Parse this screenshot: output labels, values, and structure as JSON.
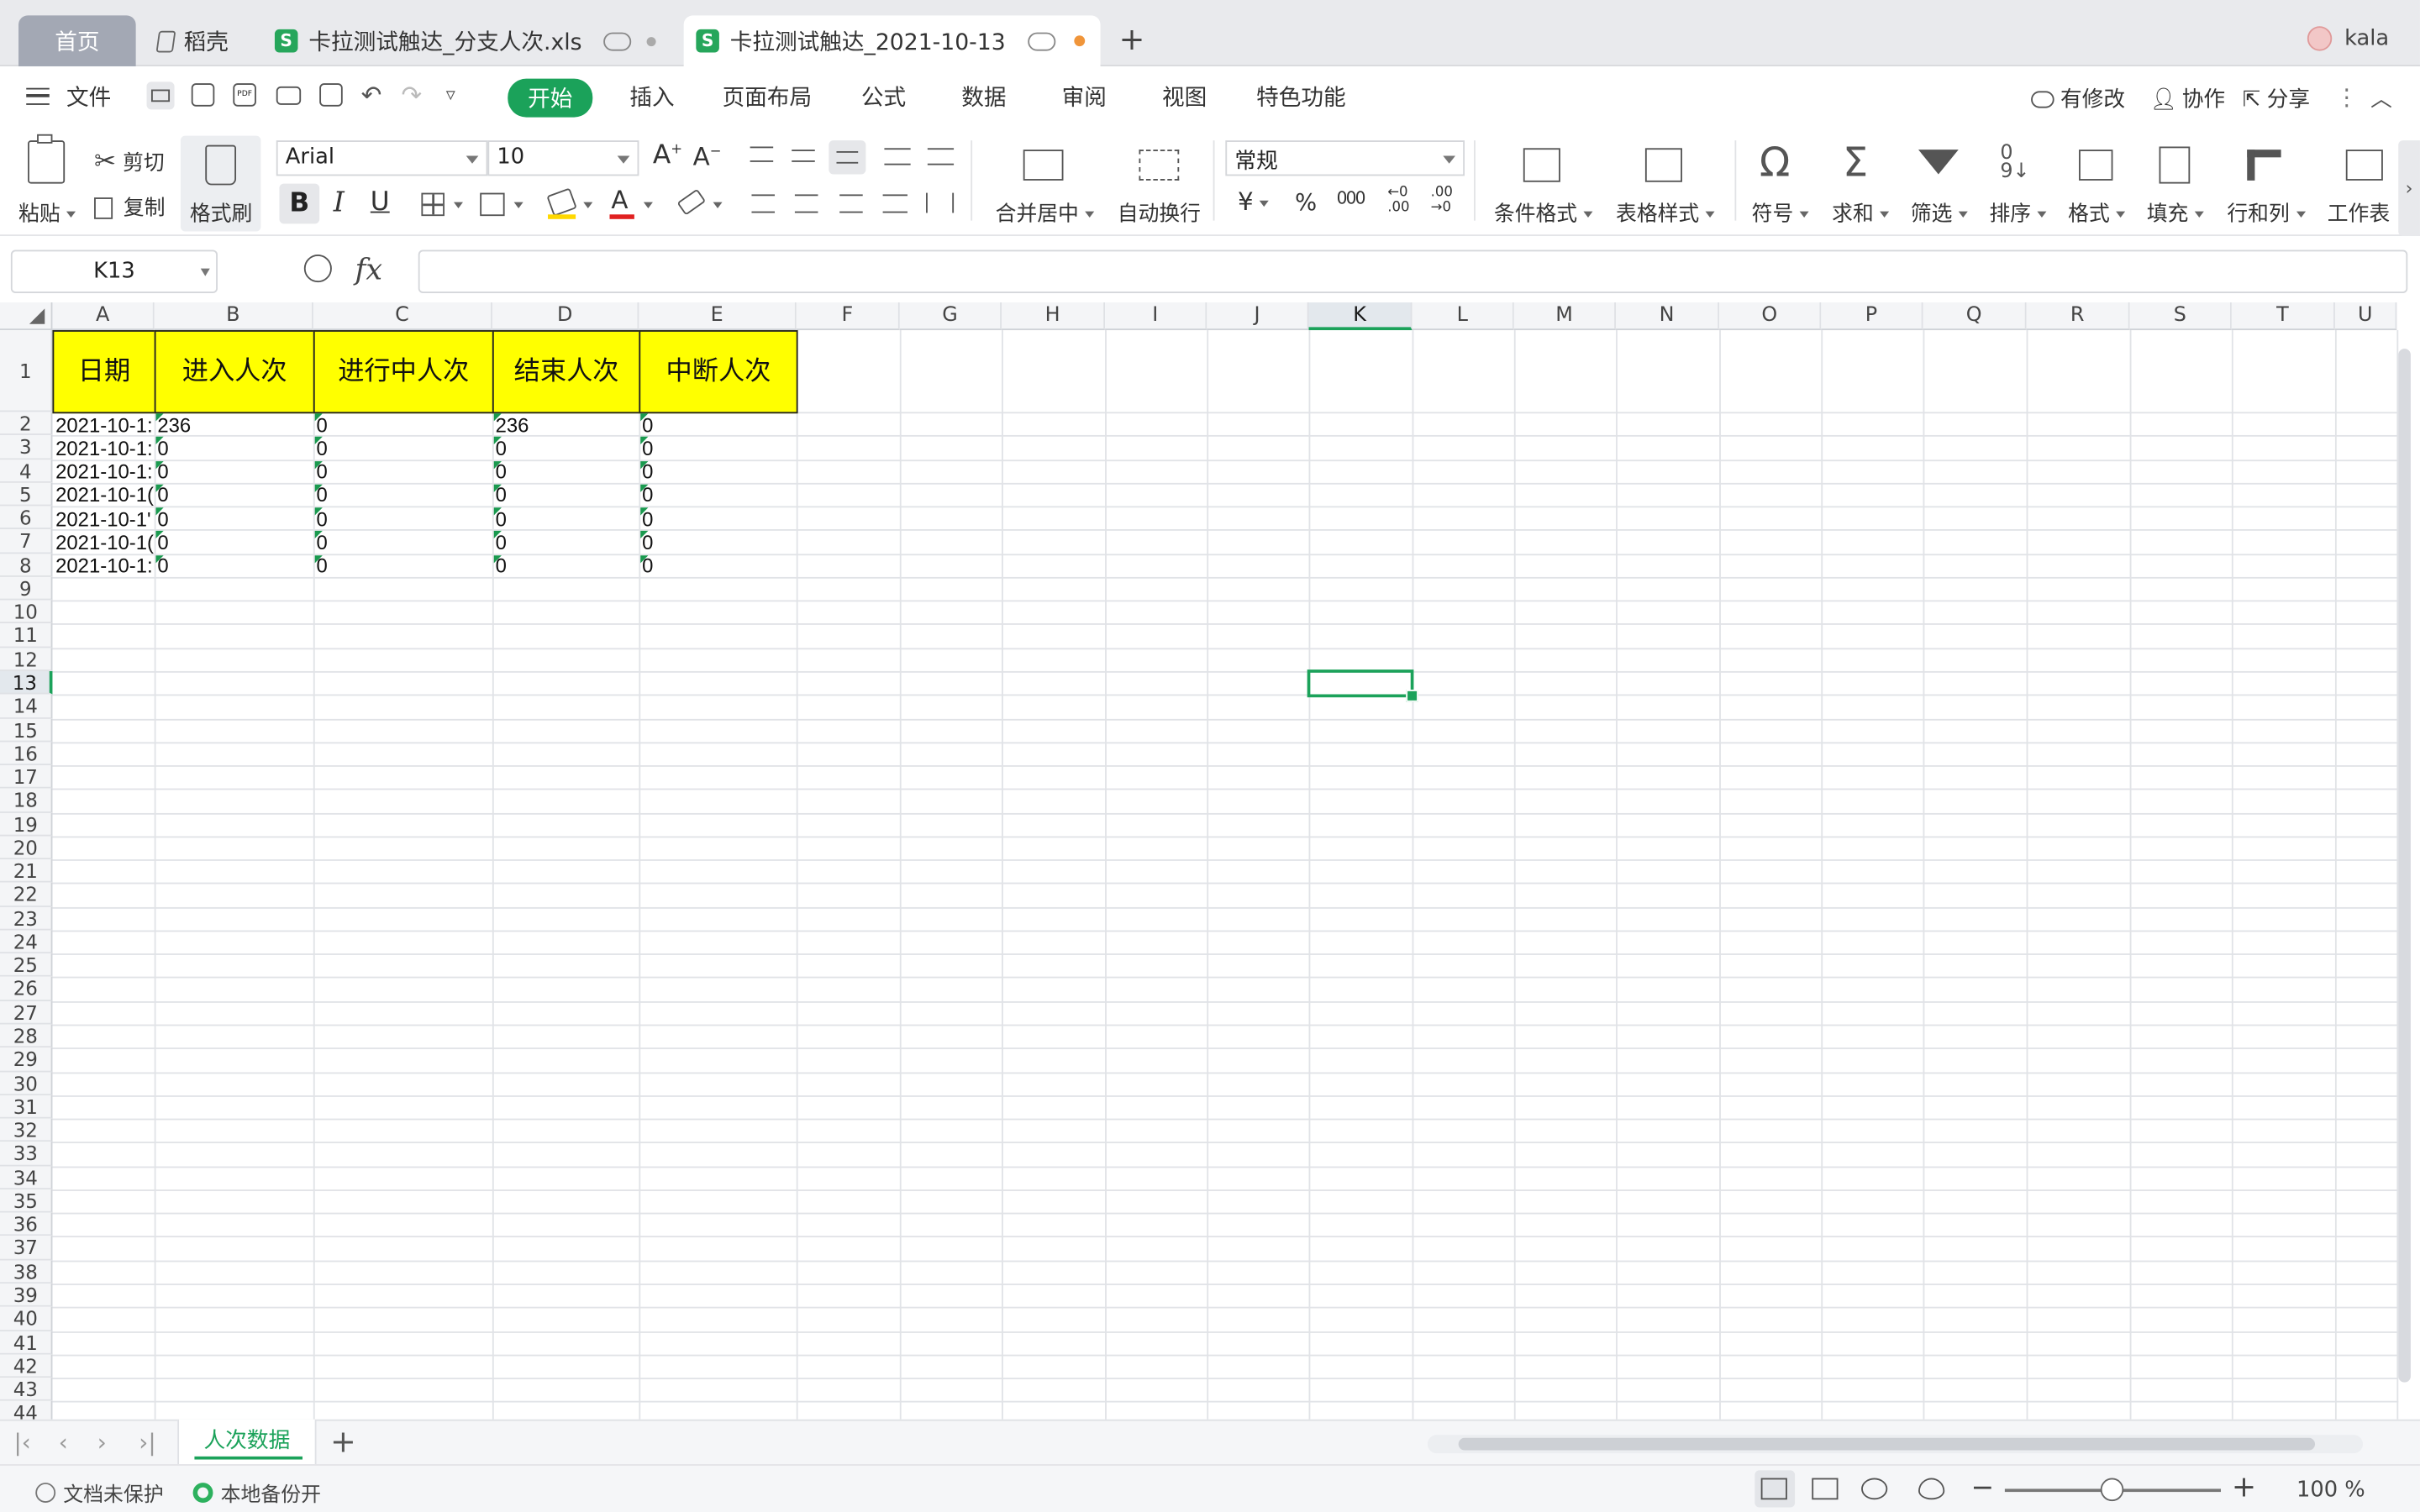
{
  "tabs": {
    "home": "首页",
    "drawer": "稻壳",
    "file1": "卡拉测试触达_分支人次.xls",
    "file2": "卡拉测试触达_2021-10-13",
    "new_tab": "+",
    "file_icon_letter": "S",
    "user": "kala"
  },
  "menu": {
    "file": "文件",
    "items": [
      "开始",
      "插入",
      "页面布局",
      "公式",
      "数据",
      "审阅",
      "视图",
      "特色功能"
    ],
    "has_changes": "有修改",
    "collab": "协作",
    "share": "分享"
  },
  "ribbon": {
    "paste": "粘贴",
    "cut": "剪切",
    "copy": "复制",
    "format_painter": "格式刷",
    "font_name": "Arial",
    "font_size": "10",
    "bold": "B",
    "italic": "I",
    "underline": "U",
    "merge_center": "合并居中",
    "auto_wrap": "自动换行",
    "number_format": "常规",
    "currency": "¥",
    "percent": "%",
    "thousands": "000",
    "inc_decimal": "←0 .00",
    "dec_decimal": ".00 →0",
    "cond_format": "条件格式",
    "table_style": "表格样式",
    "symbol": "符号",
    "sum": "求和",
    "filter": "筛选",
    "sort": "排序",
    "format": "格式",
    "fill": "填充",
    "row_col": "行和列",
    "worksheet": "工作表"
  },
  "formula_bar": {
    "name_box": "K13",
    "fx": "fx",
    "content": ""
  },
  "sheet": {
    "columns": [
      "A",
      "B",
      "C",
      "D",
      "E",
      "F",
      "G",
      "H",
      "I",
      "J",
      "K",
      "L",
      "M",
      "N",
      "O",
      "P",
      "Q",
      "R",
      "S",
      "T",
      "U"
    ],
    "selected_column": "K",
    "selected_row": 13,
    "header_row": [
      "日期",
      "进入人次",
      "进行中人次",
      "结束人次",
      "中断人次"
    ],
    "rows": [
      [
        "2021-10-1:",
        "236",
        "0",
        "236",
        "0"
      ],
      [
        "2021-10-1:",
        "0",
        "0",
        "0",
        "0"
      ],
      [
        "2021-10-1:",
        "0",
        "0",
        "0",
        "0"
      ],
      [
        "2021-10-1(",
        "0",
        "0",
        "0",
        "0"
      ],
      [
        "2021-10-1'",
        "0",
        "0",
        "0",
        "0"
      ],
      [
        "2021-10-1(",
        "0",
        "0",
        "0",
        "0"
      ],
      [
        "2021-10-1:",
        "0",
        "0",
        "0",
        "0"
      ]
    ],
    "header_fill": "#ffff00",
    "accent": "#1ba25a"
  },
  "sheet_tabs": {
    "active": "人次数据",
    "add": "+"
  },
  "status": {
    "protect": "文档未保护",
    "backup": "本地备份开",
    "zoom": "100 %"
  }
}
